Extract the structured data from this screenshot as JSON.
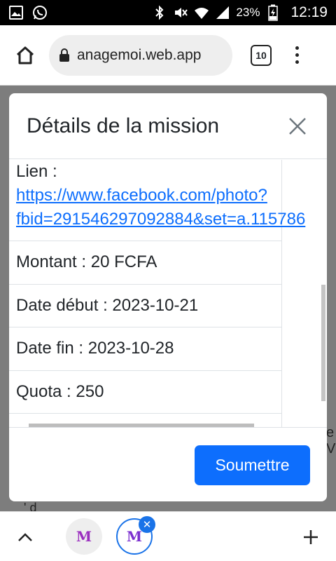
{
  "statusbar": {
    "battery": "23%",
    "time": "12:19"
  },
  "browser": {
    "url": "anagemoi.web.app",
    "tab_count": "10"
  },
  "background": {
    "right_hint": "e V",
    "bottom_hint": "' d"
  },
  "modal": {
    "title": "Détails de la mission",
    "lien_label": "Lien :",
    "lien_line1": "https://www.facebook.com/photo?",
    "lien_line2": "fbid=291546297092884&set=a.115786",
    "montant": "Montant : 20 FCFA",
    "date_debut": "Date début : 2023-10-21",
    "date_fin": "Date fin : 2023-10-28",
    "quota": "Quota : 250",
    "submit_label": "Soumettre"
  },
  "bottombar": {
    "tab1_logo": "M",
    "tab2_logo": "M"
  },
  "colors": {
    "primary": "#0d6efd",
    "link": "#0d6efd",
    "chrome_blue": "#1a73e8"
  }
}
